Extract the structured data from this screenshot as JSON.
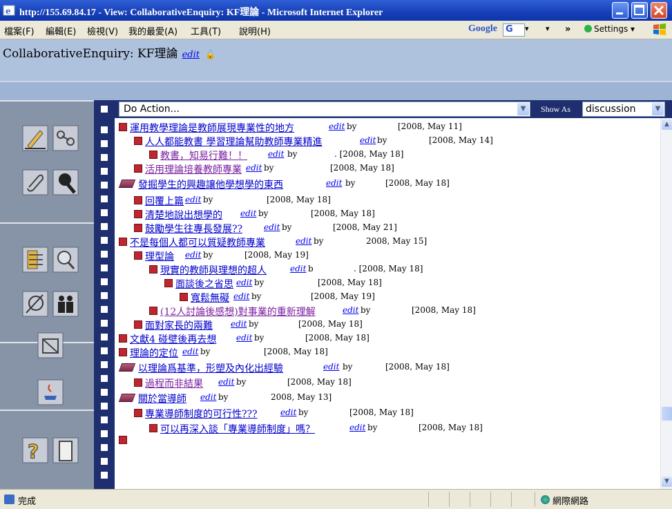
{
  "window": {
    "title": "http://155.69.84.17 - View: CollaborativeEnquiry: KF理論 - Microsoft Internet Explorer"
  },
  "menu": {
    "items": [
      "檔案(F)",
      "編輯(E)",
      "檢視(V)",
      "我的最愛(A)",
      "工具(T)",
      "說明(H)"
    ],
    "google": "Google",
    "google_g": "G",
    "chevrons": "»",
    "settings": "Settings"
  },
  "page": {
    "title": "CollaborativeEnquiry: KF理論",
    "edit_label": "edit"
  },
  "actionbar": {
    "do_action": "Do Action...",
    "show_as_label": "Show As",
    "show_as_value": "discussion"
  },
  "notes": [
    {
      "title": "運用教學理論是教師展現專業性的地方",
      "edit": "edit",
      "by": "by",
      "date": "[2008, May 11]"
    },
    {
      "title": "人人都能教書 學習理論幫助教師專業精進",
      "edit": "edit",
      "by": "by",
      "date": "[2008, May 14]"
    },
    {
      "title": "教書，知易行難！！",
      "edit": "edit",
      "by": "by",
      "date": ". [2008, May 18]"
    },
    {
      "title": "活用理論培養教師專業",
      "edit": "edit",
      "by": "by",
      "date": "[2008, May 18]"
    },
    {
      "title": "發掘學生的興趣讓他學想學的東西",
      "edit": "edit",
      "by": "by",
      "date": "[2008, May 18]"
    },
    {
      "title": "回覆上篇",
      "edit": "edit",
      "by": "by",
      "date": "[2008, May 18]"
    },
    {
      "title": "清楚地說出想學的",
      "edit": "edit",
      "by": "by",
      "date": "[2008, May 18]"
    },
    {
      "title": "鼓勵學生往專長發展??",
      "edit": "edit",
      "by": "by",
      "date": "[2008, May 21]"
    },
    {
      "title": "不是每個人都可以質疑教師專業",
      "edit": "edit",
      "by": "by",
      "date": "2008, May 15]"
    },
    {
      "title": "理型論",
      "edit": "edit",
      "by": "by",
      "date": "[2008, May 19]"
    },
    {
      "title": "現實的教師與理想的超人",
      "edit": "edit",
      "by": "b",
      "date": ". [2008, May 18]"
    },
    {
      "title": "面談後之省思",
      "edit": "edit",
      "by": "by",
      "date": "[2008, May 18]"
    },
    {
      "title": "寬鬆無礙",
      "edit": "edit",
      "by": "by",
      "date": "[2008, May 19]"
    },
    {
      "title": "(12人討論後感想)對事業的重新理解",
      "edit": "edit",
      "by": "by",
      "date": "[2008, May 18]"
    },
    {
      "title": "面對家長的兩難",
      "edit": "edit",
      "by": "by",
      "date": "[2008, May 18]"
    },
    {
      "title": "文獻4 碰壁後再去想",
      "edit": "edit",
      "by": "by",
      "date": "[2008, May 18]"
    },
    {
      "title": "理論的定位",
      "edit": "edit",
      "by": "by",
      "date": "[2008, May 18]"
    },
    {
      "title": "以理論爲基準，形塑及內化出經驗",
      "edit": "edit",
      "by": "by",
      "date": "[2008, May 18]"
    },
    {
      "title": "過程而非結果",
      "edit": "edit",
      "by": "by",
      "date": "[2008, May 18]"
    },
    {
      "title": "關於當導師",
      "edit": "edit",
      "by": "by",
      "date": "2008, May 13]"
    },
    {
      "title": "專業導師制度的可行性???",
      "edit": "edit",
      "by": "by",
      "date": "[2008, May 18]"
    },
    {
      "title": "可以再深入談「專業導師制度」嗎？",
      "edit": "edit",
      "by": "by",
      "date": "[2008, May 18]"
    }
  ],
  "status": {
    "text": "完成",
    "zone": "網際網路"
  }
}
